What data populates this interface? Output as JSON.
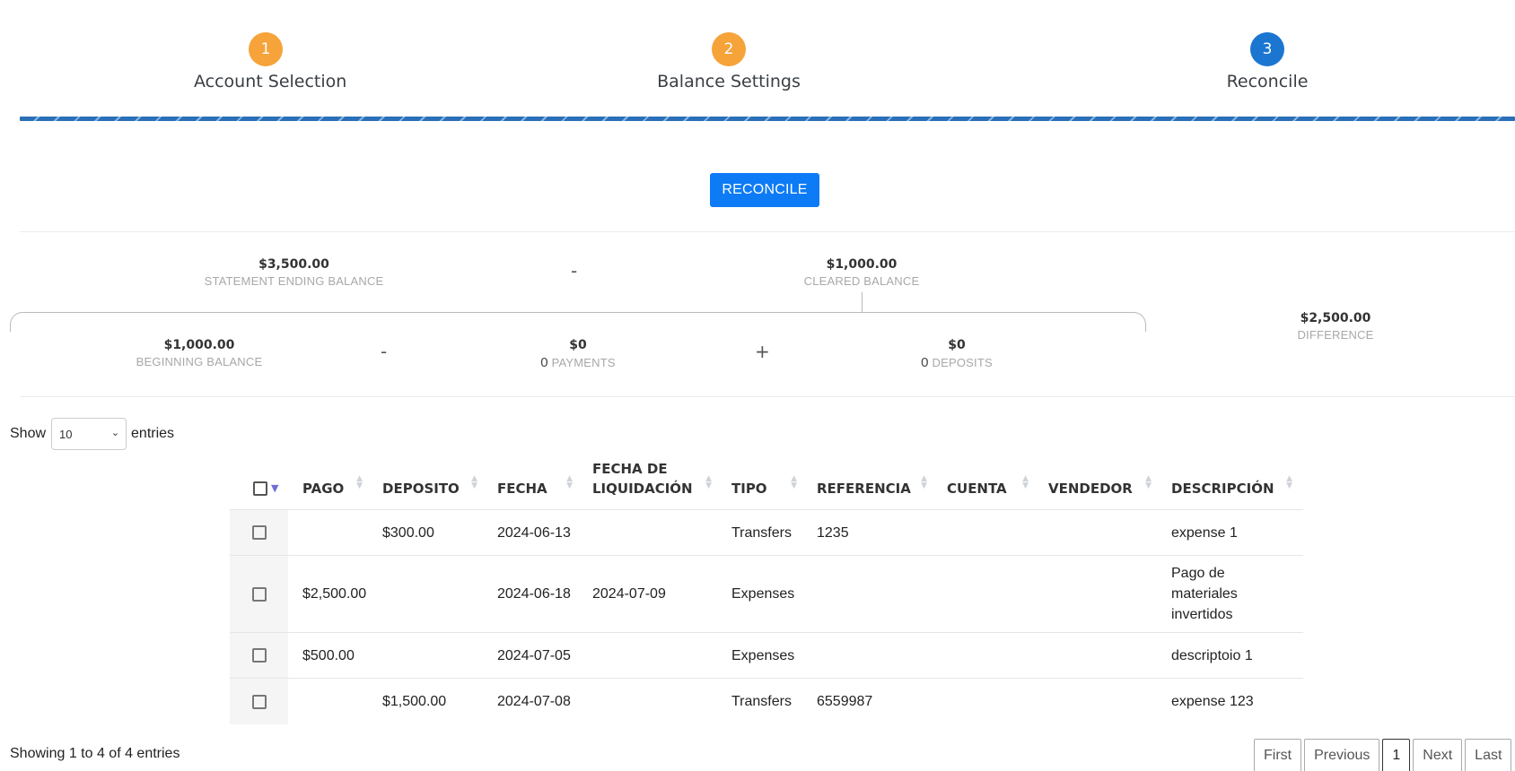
{
  "steps": [
    {
      "number": "1",
      "label": "Account Selection",
      "color": "#f6a33a"
    },
    {
      "number": "2",
      "label": "Balance Settings",
      "color": "#f6a33a"
    },
    {
      "number": "3",
      "label": "Reconcile",
      "color": "#1b76d2"
    }
  ],
  "reconcile_button": "RECONCILE",
  "summary": {
    "statement_ending": {
      "amount": "$3,500.00",
      "label": "STATEMENT ENDING BALANCE"
    },
    "op_minus_1": "-",
    "cleared": {
      "amount": "$1,000.00",
      "label": "CLEARED BALANCE"
    },
    "difference": {
      "amount": "$2,500.00",
      "label": "DIFFERENCE"
    },
    "beginning": {
      "amount": "$1,000.00",
      "label": "BEGINNING BALANCE"
    },
    "op_minus_2": "-",
    "payments": {
      "amount": "$0",
      "count": "0",
      "label": "PAYMENTS"
    },
    "op_plus": "+",
    "deposits": {
      "amount": "$0",
      "count": "0",
      "label": "DEPOSITS"
    }
  },
  "entries": {
    "show_label": "Show",
    "value": "10",
    "suffix": "entries"
  },
  "table": {
    "headers": {
      "pago": "PAGO",
      "deposito": "DEPOSITO",
      "fecha": "FECHA",
      "fecha_liq_1": "FECHA DE",
      "fecha_liq_2": "LIQUIDACIÓN",
      "tipo": "TIPO",
      "referencia": "REFERENCIA",
      "cuenta": "CUENTA",
      "vendedor": "VENDEDOR",
      "descripcion": "DESCRIPCIÓN"
    },
    "rows": [
      {
        "pago": "",
        "deposito": "$300.00",
        "fecha": "2024-06-13",
        "fecha_liq": "",
        "tipo": "Transfers",
        "referencia": "1235",
        "cuenta": "",
        "vendedor": "",
        "descripcion": "expense 1"
      },
      {
        "pago": "$2,500.00",
        "deposito": "",
        "fecha": "2024-06-18",
        "fecha_liq": "2024-07-09",
        "tipo": "Expenses",
        "referencia": "",
        "cuenta": "",
        "vendedor": "",
        "descripcion": "Pago de materiales invertidos"
      },
      {
        "pago": "$500.00",
        "deposito": "",
        "fecha": "2024-07-05",
        "fecha_liq": "",
        "tipo": "Expenses",
        "referencia": "",
        "cuenta": "",
        "vendedor": "",
        "descripcion": "descriptoio 1"
      },
      {
        "pago": "",
        "deposito": "$1,500.00",
        "fecha": "2024-07-08",
        "fecha_liq": "",
        "tipo": "Transfers",
        "referencia": "6559987",
        "cuenta": "",
        "vendedor": "",
        "descripcion": "expense 123"
      }
    ]
  },
  "info": "Showing 1 to 4 of 4 entries",
  "pagination": {
    "first": "First",
    "previous": "Previous",
    "current": "1",
    "next": "Next",
    "last": "Last"
  }
}
